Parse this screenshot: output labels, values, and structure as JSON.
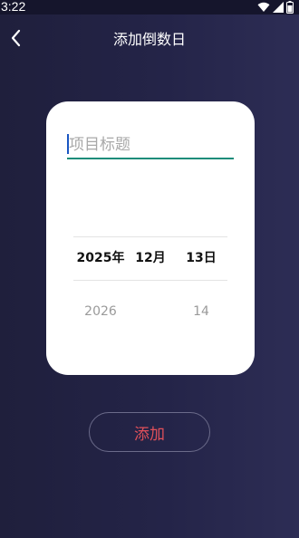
{
  "status_bar": {
    "time": "3:22",
    "icons": [
      "wifi-icon",
      "signal-icon",
      "battery-icon"
    ]
  },
  "app_bar": {
    "back_icon": "chevron-left-icon",
    "title": "添加倒数日"
  },
  "form": {
    "title_input": {
      "placeholder": "项目标题",
      "value": ""
    },
    "date_picker": {
      "selected": {
        "year": "2025年",
        "month": "12月",
        "day": "13日"
      },
      "next": {
        "year": "2026",
        "month": "",
        "day": "14"
      }
    }
  },
  "actions": {
    "add_label": "添加"
  },
  "colors": {
    "background": "#242448",
    "card": "#ffffff",
    "input_underline": "#1a8c7a",
    "caret": "#1a56c2",
    "add_text": "#e0505a"
  }
}
